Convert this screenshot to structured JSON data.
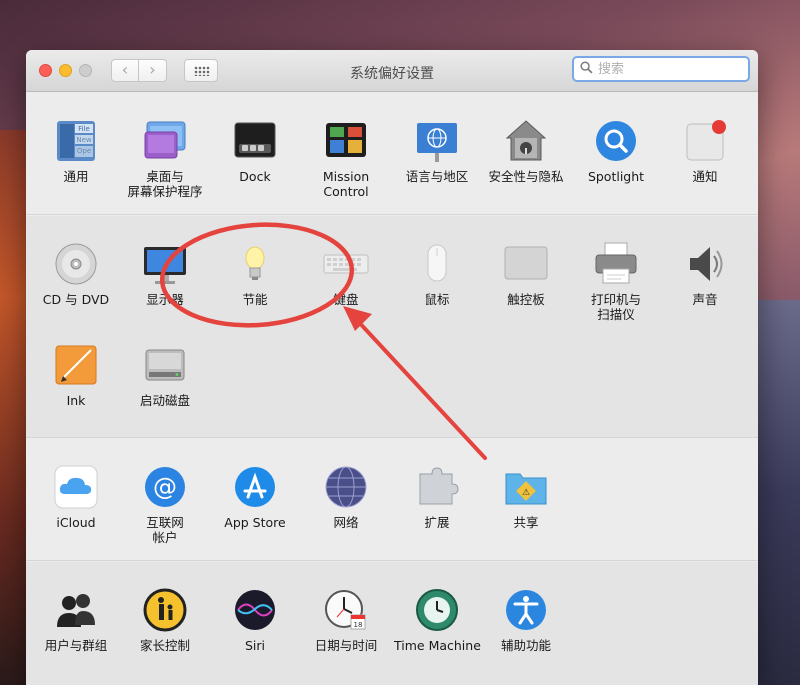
{
  "window": {
    "title": "系统偏好设置",
    "search_placeholder": "搜索"
  },
  "sections": [
    {
      "items": [
        {
          "id": "general",
          "label": "通用",
          "icon": "general-icon"
        },
        {
          "id": "desktop",
          "label": "桌面与\n屏幕保护程序",
          "icon": "desktop-screensaver-icon"
        },
        {
          "id": "dock",
          "label": "Dock",
          "icon": "dock-icon"
        },
        {
          "id": "mission-control",
          "label": "Mission\nControl",
          "icon": "mission-control-icon"
        },
        {
          "id": "language",
          "label": "语言与地区",
          "icon": "language-region-icon"
        },
        {
          "id": "security",
          "label": "安全性与隐私",
          "icon": "security-privacy-icon"
        },
        {
          "id": "spotlight",
          "label": "Spotlight",
          "icon": "spotlight-icon"
        },
        {
          "id": "notifications",
          "label": "通知",
          "icon": "notifications-icon"
        }
      ]
    },
    {
      "items": [
        {
          "id": "cd-dvd",
          "label": "CD 与 DVD",
          "icon": "cd-dvd-icon"
        },
        {
          "id": "displays",
          "label": "显示器",
          "icon": "displays-icon"
        },
        {
          "id": "energy",
          "label": "节能",
          "icon": "energy-saver-icon"
        },
        {
          "id": "keyboard",
          "label": "键盘",
          "icon": "keyboard-icon"
        },
        {
          "id": "mouse",
          "label": "鼠标",
          "icon": "mouse-icon"
        },
        {
          "id": "trackpad",
          "label": "触控板",
          "icon": "trackpad-icon"
        },
        {
          "id": "printers",
          "label": "打印机与\n扫描仪",
          "icon": "printer-scanner-icon"
        },
        {
          "id": "sound",
          "label": "声音",
          "icon": "sound-icon"
        },
        {
          "id": "ink",
          "label": "Ink",
          "icon": "ink-icon"
        },
        {
          "id": "startup-disk",
          "label": "启动磁盘",
          "icon": "startup-disk-icon"
        }
      ]
    },
    {
      "items": [
        {
          "id": "icloud",
          "label": "iCloud",
          "icon": "icloud-icon"
        },
        {
          "id": "internet-accounts",
          "label": "互联网\n帐户",
          "icon": "internet-accounts-icon"
        },
        {
          "id": "app-store",
          "label": "App Store",
          "icon": "app-store-icon"
        },
        {
          "id": "network",
          "label": "网络",
          "icon": "network-icon"
        },
        {
          "id": "extensions",
          "label": "扩展",
          "icon": "extensions-icon"
        },
        {
          "id": "sharing",
          "label": "共享",
          "icon": "sharing-icon"
        }
      ]
    },
    {
      "items": [
        {
          "id": "users",
          "label": "用户与群组",
          "icon": "users-groups-icon"
        },
        {
          "id": "parental",
          "label": "家长控制",
          "icon": "parental-controls-icon"
        },
        {
          "id": "siri",
          "label": "Siri",
          "icon": "siri-icon"
        },
        {
          "id": "datetime",
          "label": "日期与时间",
          "icon": "date-time-icon"
        },
        {
          "id": "time-machine",
          "label": "Time Machine",
          "icon": "time-machine-icon"
        },
        {
          "id": "accessibility",
          "label": "辅助功能",
          "icon": "accessibility-icon"
        }
      ]
    }
  ],
  "colors": {
    "annotation": "#e5433d",
    "search_focus": "#7aa8e6"
  }
}
